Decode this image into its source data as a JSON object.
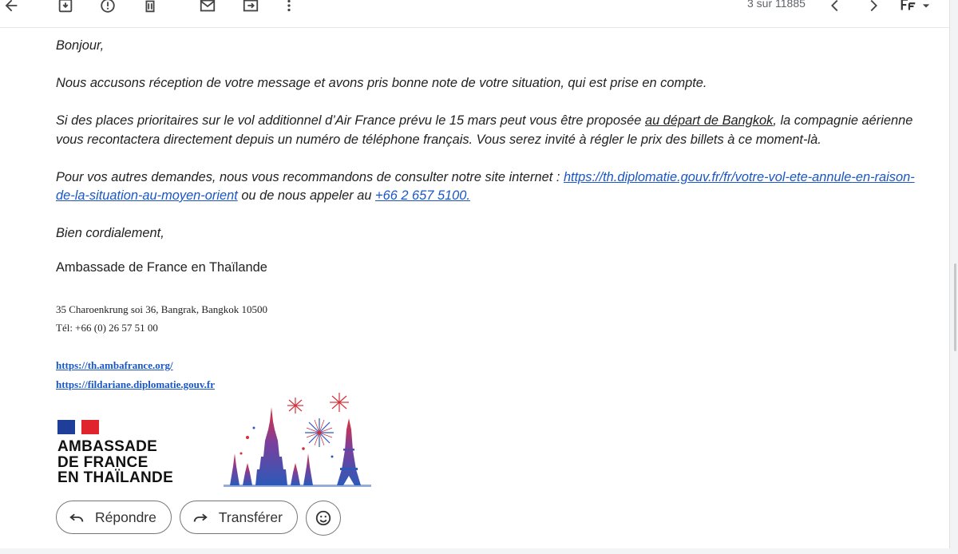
{
  "toolbar": {
    "pager_text": "3 sur 11885",
    "icons": [
      "back-arrow-icon",
      "archive-icon",
      "report-spam-icon",
      "delete-icon",
      "mark-unread-icon",
      "move-to-icon",
      "more-vert-icon",
      "prev-icon",
      "next-icon",
      "input-tools-icon",
      "dropdown-icon"
    ]
  },
  "email": {
    "greeting": "Bonjour,",
    "para1": "Nous accusons réception de votre message et avons pris bonne note de votre situation, qui est prise en compte.",
    "para2_before": "Si des places prioritaires sur le vol additionnel d’Air France prévu le 15 mars peut vous être proposée ",
    "para2_underlined": "au départ de Bangkok",
    "para2_after": ", la compagnie aérienne vous recontactera directement depuis un numéro de téléphone français. Vous serez invité à régler le prix des billets à ce moment-là.",
    "para3_before": "Pour vos autres demandes, nous vous recommandons de consulter notre site internet : ",
    "para3_link": "https://th.diplomatie.gouv.fr/fr/votre-vol-ete-annule-en-raison-de-la-situation-au-moyen-orient",
    "para3_middle": " ou de nous appeler au ",
    "para3_phone": "+66 2 657 5100.",
    "closing": "Bien cordialement,"
  },
  "signature": {
    "name": "Ambassade de France en Thaïlande",
    "address": "35 Charoenkrung soi 36, Bangrak, Bangkok 10500",
    "phone": "Tél: +66 (0) 26 57 51 00",
    "link1": "https://th.ambafrance.org/",
    "link2": "https://fildariane.diplomatie.gouv.fr",
    "logo_line1": "AMBASSADE",
    "logo_line2": "DE FRANCE",
    "logo_line3": "EN THAÏLANDE"
  },
  "actions": {
    "reply_label": "Répondre",
    "forward_label": "Transférer"
  }
}
